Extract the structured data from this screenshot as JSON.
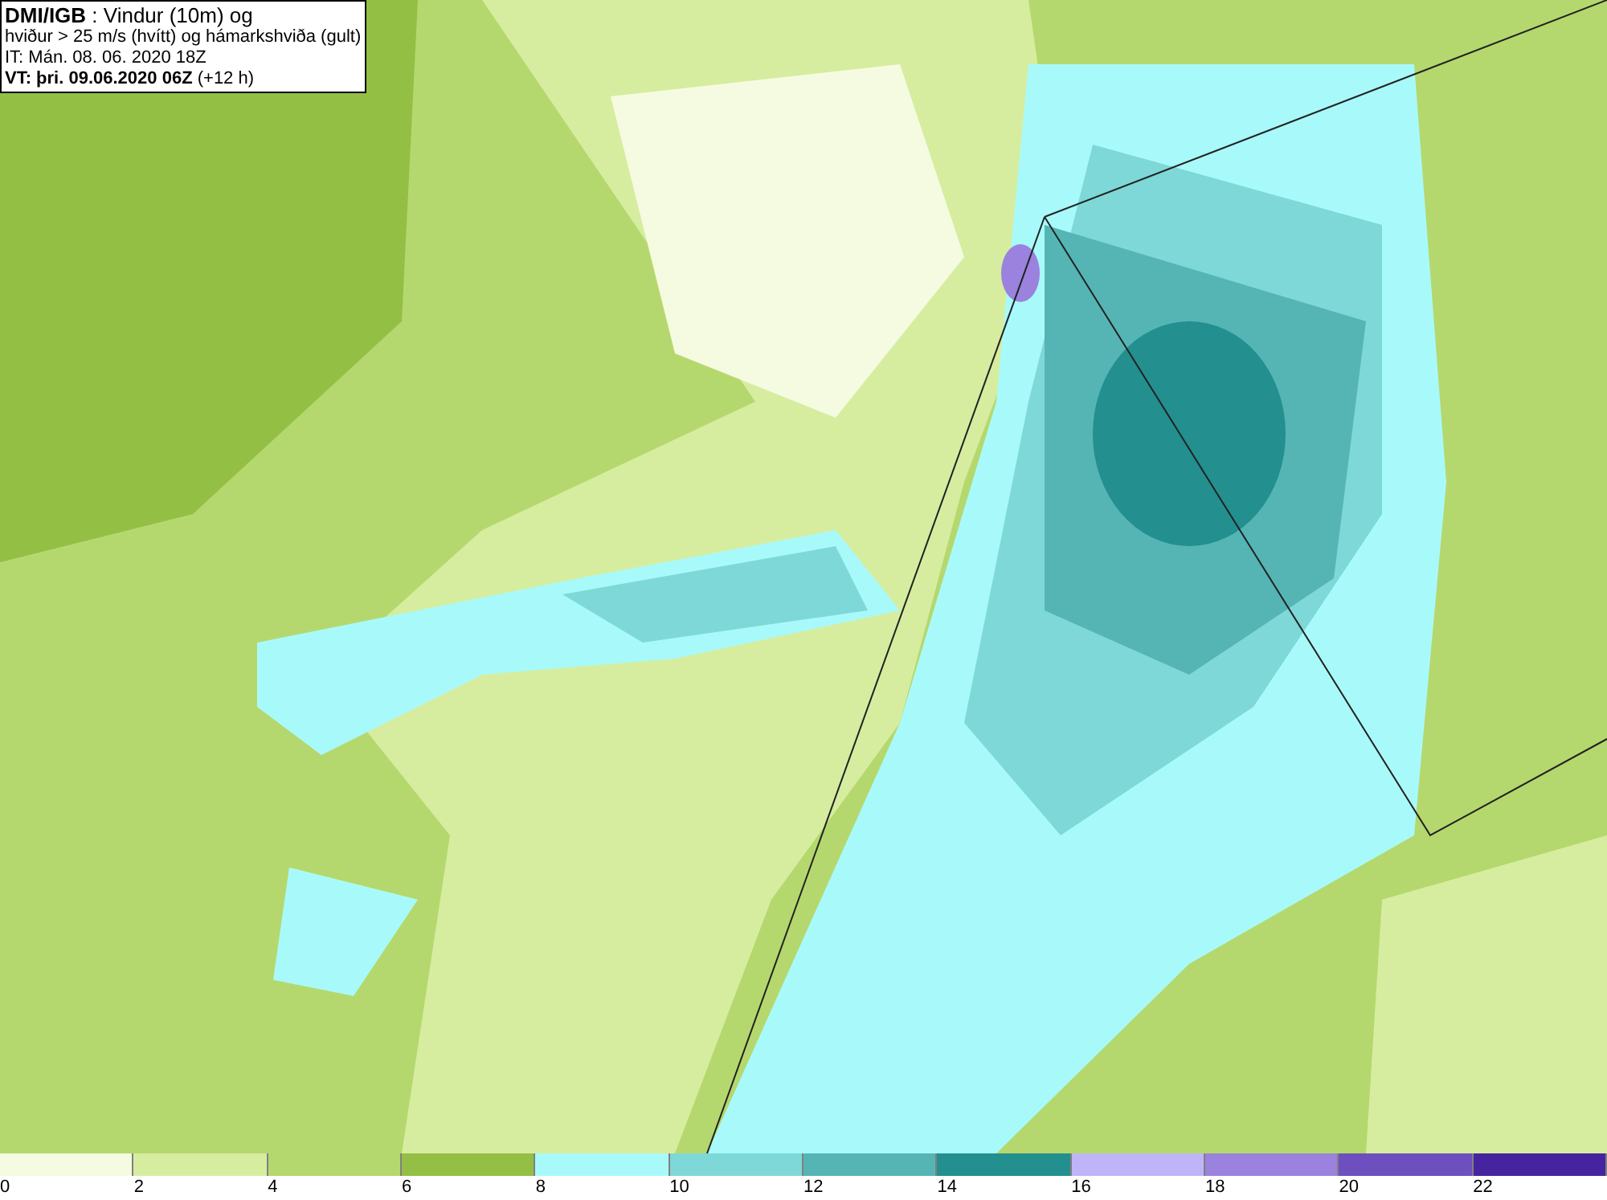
{
  "header": {
    "lines": [
      "**DMI/IGB** : Vindur (10m) og",
      "hviður > 25 m/s (hvítt) og hámarkshviða (gult)",
      "IT: Mán. 08. 06. 2020 18Z",
      "**VT: þri. 09.06.2020 06Z** (+12 h)"
    ]
  },
  "legend": [
    {
      "label": "0",
      "color": "#f5fbe0"
    },
    {
      "label": "2",
      "color": "#d6eda0"
    },
    {
      "label": "4",
      "color": "#b5d86e"
    },
    {
      "label": "6",
      "color": "#93bf44"
    },
    {
      "label": "8",
      "color": "#a8fafa"
    },
    {
      "label": "10",
      "color": "#7fd8d8"
    },
    {
      "label": "12",
      "color": "#55b5b5"
    },
    {
      "label": "14",
      "color": "#238f8f"
    },
    {
      "label": "16",
      "color": "#c0b4f8"
    },
    {
      "label": "18",
      "color": "#9a82de"
    },
    {
      "label": "20",
      "color": "#6e4fbf"
    },
    {
      "label": "22",
      "color": "#4624a0"
    }
  ]
}
